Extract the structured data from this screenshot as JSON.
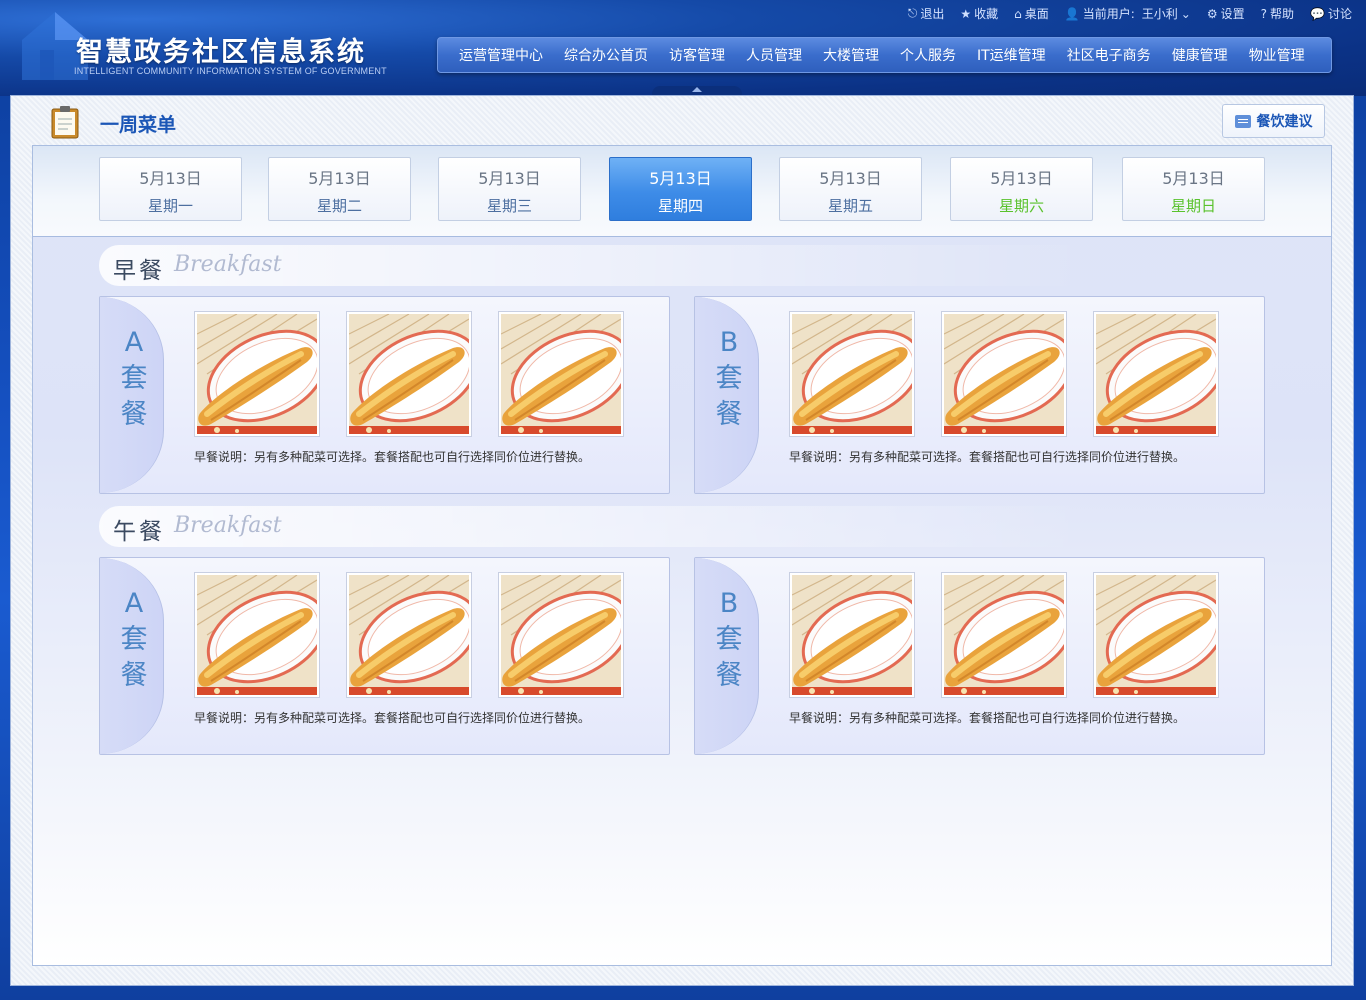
{
  "header": {
    "title": "智慧政务社区信息系统",
    "subtitle": "INTELLIGENT COMMUNITY INFORMATION SYSTEM OF GOVERNMENT",
    "toplinks": [
      {
        "label": "退出",
        "icon": "logout-icon"
      },
      {
        "label": "收藏",
        "icon": "star-icon"
      },
      {
        "label": "桌面",
        "icon": "home-icon"
      },
      {
        "label": "当前用户:",
        "icon": "user-icon"
      },
      {
        "label": "王小利",
        "icon": "chevron-down-icon"
      },
      {
        "label": "设置",
        "icon": "gear-icon"
      },
      {
        "label": "帮助",
        "icon": "help-icon"
      },
      {
        "label": "讨论",
        "icon": "chat-icon"
      }
    ],
    "nav": [
      "运营管理中心",
      "综合办公首页",
      "访客管理",
      "人员管理",
      "大楼管理",
      "个人服务",
      "IT运维管理",
      "社区电子商务",
      "健康管理",
      "物业管理"
    ]
  },
  "page": {
    "title": "一周菜单",
    "advice_button": "餐饮建议"
  },
  "days": [
    {
      "date": "5月13日",
      "weekday": "星期一",
      "active": false,
      "weekend": false
    },
    {
      "date": "5月13日",
      "weekday": "星期二",
      "active": false,
      "weekend": false
    },
    {
      "date": "5月13日",
      "weekday": "星期三",
      "active": false,
      "weekend": false
    },
    {
      "date": "5月13日",
      "weekday": "星期四",
      "active": true,
      "weekend": false
    },
    {
      "date": "5月13日",
      "weekday": "星期五",
      "active": false,
      "weekend": false
    },
    {
      "date": "5月13日",
      "weekday": "星期六",
      "active": false,
      "weekend": true
    },
    {
      "date": "5月13日",
      "weekday": "星期日",
      "active": false,
      "weekend": true
    }
  ],
  "meals": [
    {
      "name_cn": "早餐",
      "name_en": "Breakfast",
      "sets": [
        {
          "letter": "A",
          "label_1": "套",
          "label_2": "餐",
          "desc": "早餐说明：另有多种配菜可选择。套餐搭配也可自行选择同价位进行替换。"
        },
        {
          "letter": "B",
          "label_1": "套",
          "label_2": "餐",
          "desc": "早餐说明：另有多种配菜可选择。套餐搭配也可自行选择同价位进行替换。"
        }
      ]
    },
    {
      "name_cn": "午餐",
      "name_en": "Breakfast",
      "sets": [
        {
          "letter": "A",
          "label_1": "套",
          "label_2": "餐",
          "desc": "早餐说明：另有多种配菜可选择。套餐搭配也可自行选择同价位进行替换。"
        },
        {
          "letter": "B",
          "label_1": "套",
          "label_2": "餐",
          "desc": "早餐说明：另有多种配菜可选择。套餐搭配也可自行选择同价位进行替换。"
        }
      ]
    }
  ],
  "food_image": "fried-dough-stick-image",
  "colors": {
    "accent": "#1b56b6",
    "weekend": "#5ac22d",
    "active_day": "#3e8ce8"
  }
}
